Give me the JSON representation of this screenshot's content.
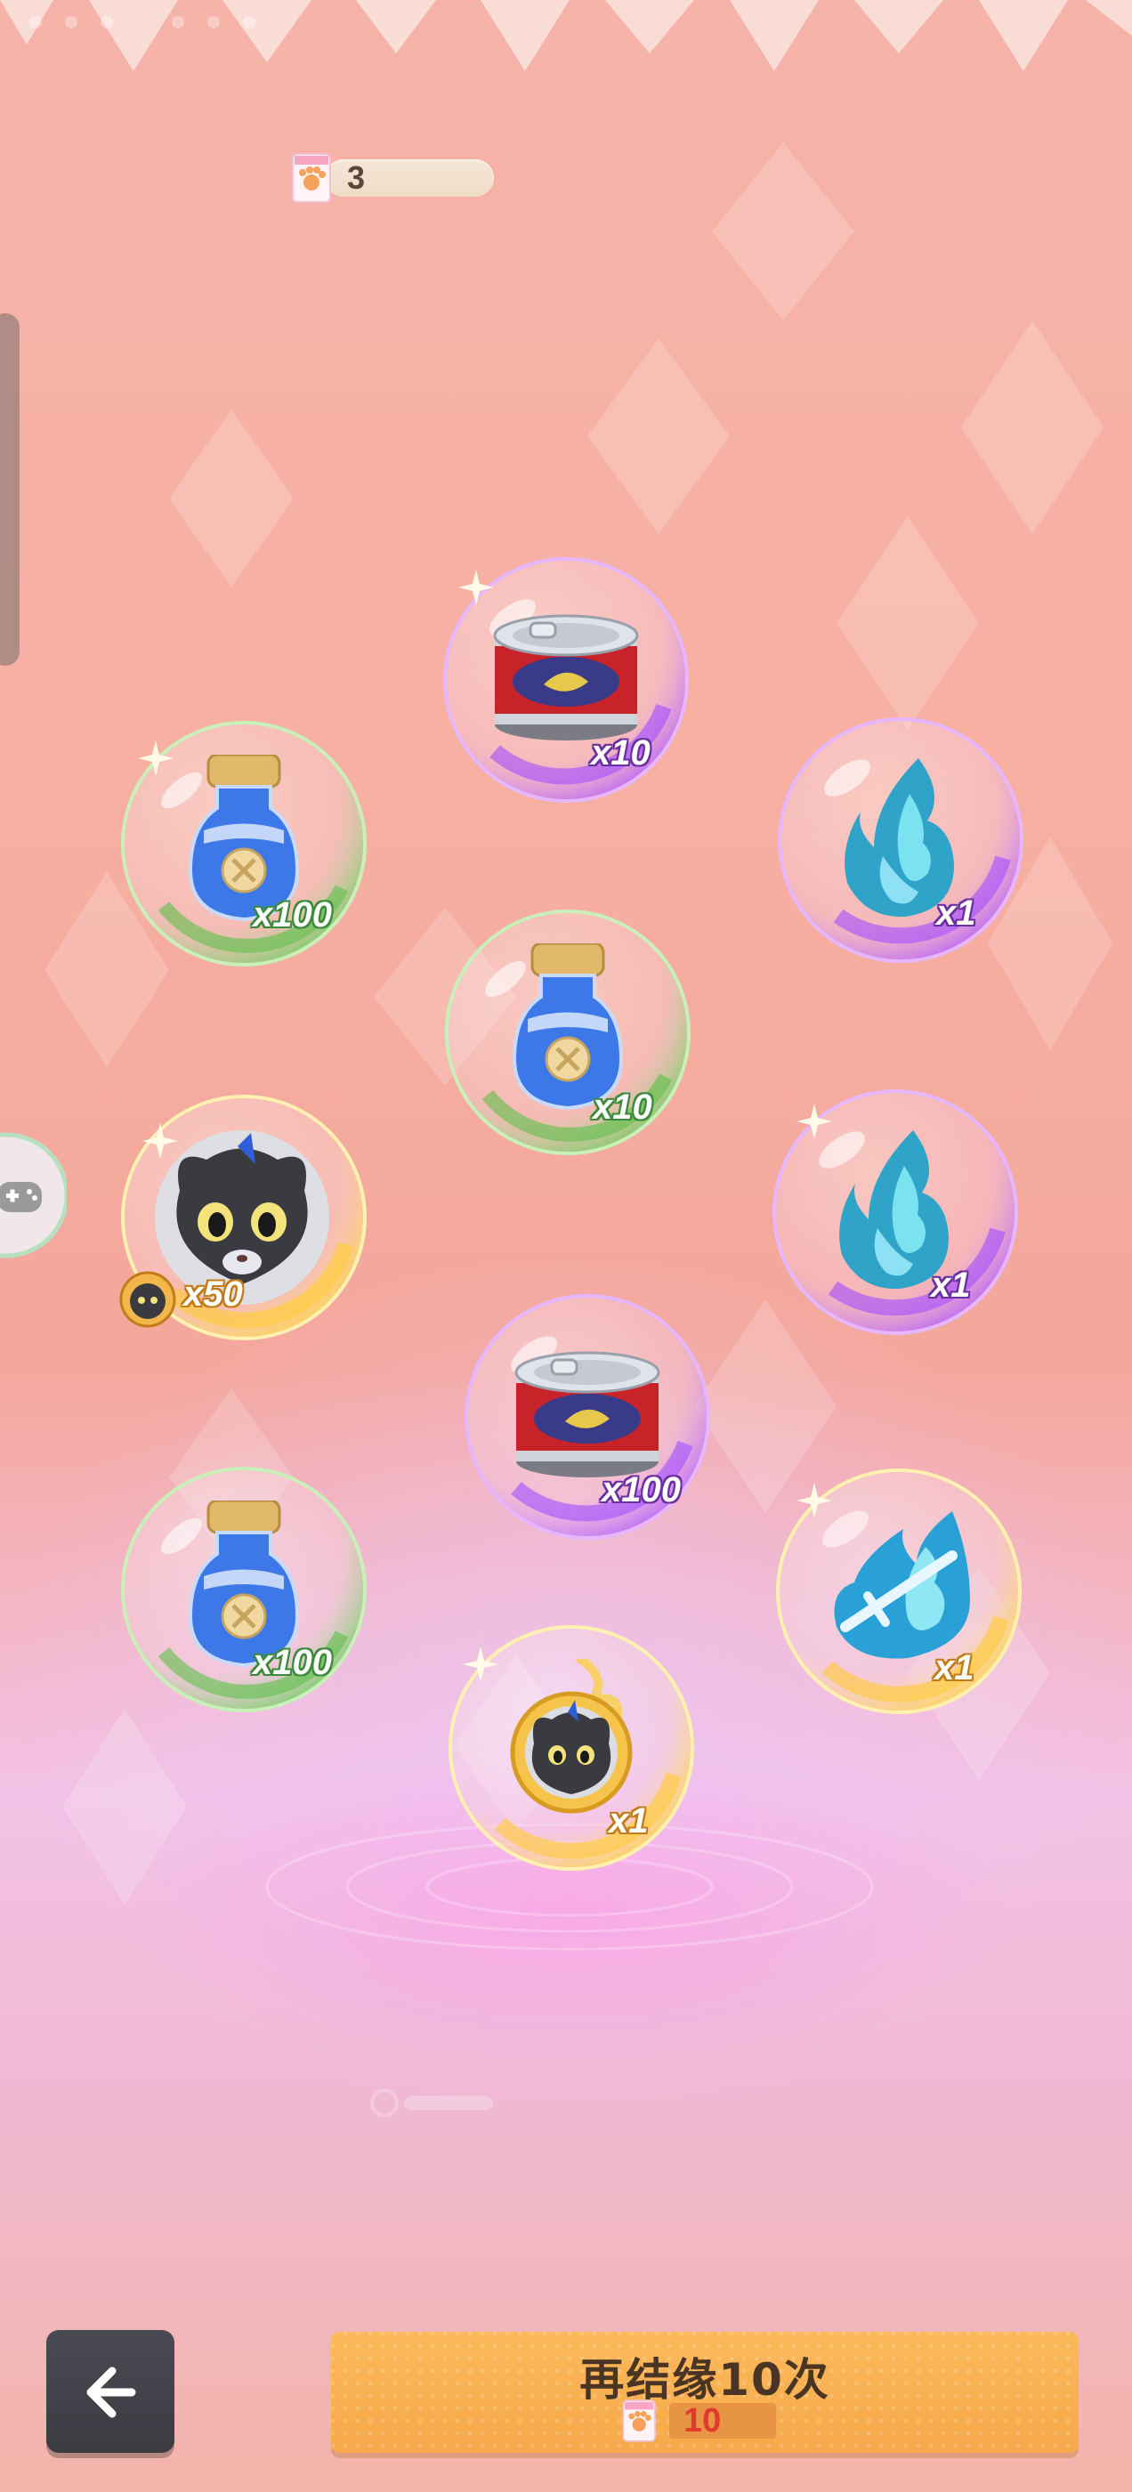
{
  "colors": {
    "qty_purple_outline": "#6a2fa0",
    "qty_green_outline": "#3b8a3a",
    "qty_gold_outline": "#c27b16",
    "button_orange": "#f6a94a",
    "back_button_dark": "#3b3c42",
    "cost_red": "#e23b2d"
  },
  "header": {
    "ticket_icon": "paw-ticket-icon",
    "ticket_count": "3"
  },
  "rewards": [
    {
      "item": "cat-food-can",
      "quantity": "x10",
      "rarity_color": "purple"
    },
    {
      "item": "star-jar",
      "quantity": "x100",
      "rarity_color": "green"
    },
    {
      "item": "blue-flame",
      "quantity": "x1",
      "rarity_color": "purple"
    },
    {
      "item": "star-jar",
      "quantity": "x10",
      "rarity_color": "green"
    },
    {
      "item": "black-cat-avatar",
      "quantity": "x50",
      "rarity_color": "gold"
    },
    {
      "item": "blue-flame",
      "quantity": "x1",
      "rarity_color": "purple"
    },
    {
      "item": "cat-food-can",
      "quantity": "x100",
      "rarity_color": "purple"
    },
    {
      "item": "star-jar",
      "quantity": "x100",
      "rarity_color": "green"
    },
    {
      "item": "blue-flame-sword",
      "quantity": "x1",
      "rarity_color": "gold"
    },
    {
      "item": "black-cat-frame",
      "quantity": "x1",
      "rarity_color": "gold"
    }
  ],
  "footer": {
    "back_icon": "back-arrow-icon",
    "redraw_label": "再结缘10次",
    "cost_icon": "paw-ticket-icon",
    "cost_value": "10"
  }
}
